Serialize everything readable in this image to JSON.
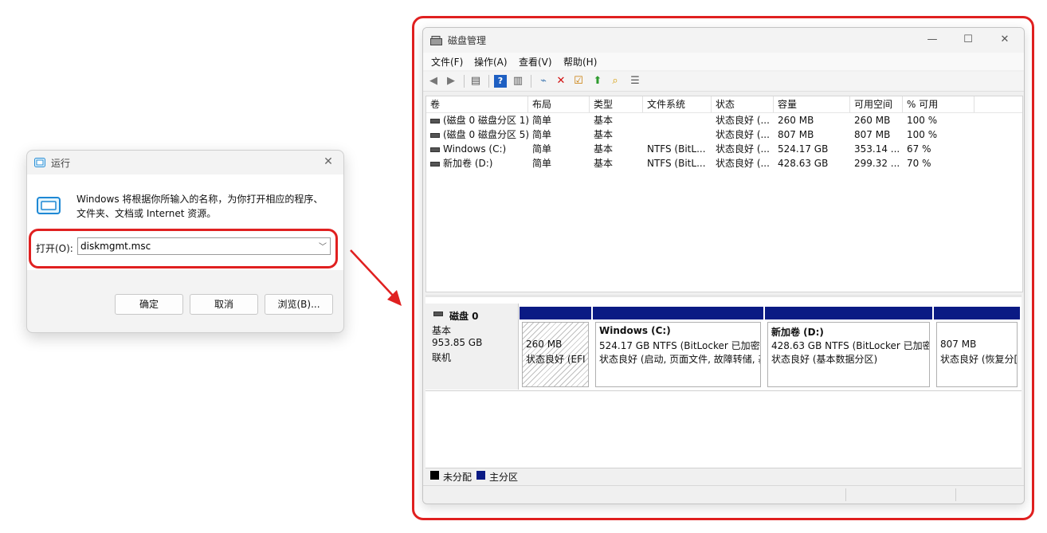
{
  "run_dialog": {
    "title": "运行",
    "description": "Windows 将根据你所输入的名称，为你打开相应的程序、文件夹、文档或 Internet 资源。",
    "open_label": "打开(O):",
    "command_value": "diskmgmt.msc",
    "ok_button": "确定",
    "cancel_button": "取消",
    "browse_button": "浏览(B)...",
    "icons": {
      "app": "run-app-icon",
      "close": "close-icon",
      "dropdown": "chevron-down-icon"
    }
  },
  "disk_mgmt": {
    "title": "磁盘管理",
    "menu": [
      "文件(F)",
      "操作(A)",
      "查看(V)",
      "帮助(H)"
    ],
    "toolbar_icons": [
      "back-icon",
      "forward-icon",
      "console-tree-icon",
      "help-icon",
      "action-pane-icon",
      "connect-icon",
      "delete-icon",
      "properties-icon",
      "up-icon",
      "search-icon",
      "view-icon"
    ],
    "columns": [
      "卷",
      "布局",
      "类型",
      "文件系统",
      "状态",
      "容量",
      "可用空间",
      "% 可用"
    ],
    "volumes": [
      [
        "(磁盘 0 磁盘分区 1)",
        "简单",
        "基本",
        "",
        "状态良好 (...",
        "260 MB",
        "260 MB",
        "100 %"
      ],
      [
        "(磁盘 0 磁盘分区 5)",
        "简单",
        "基本",
        "",
        "状态良好 (...",
        "807 MB",
        "807 MB",
        "100 %"
      ],
      [
        "Windows (C:)",
        "简单",
        "基本",
        "NTFS (BitL...",
        "状态良好 (...",
        "524.17 GB",
        "353.14 ...",
        "67 %"
      ],
      [
        "新加卷 (D:)",
        "简单",
        "基本",
        "NTFS (BitL...",
        "状态良好 (...",
        "428.63 GB",
        "299.32 ...",
        "70 %"
      ]
    ],
    "disk": {
      "name": "磁盘 0",
      "type": "基本",
      "size": "953.85 GB",
      "status": "联机",
      "partitions": [
        {
          "title": "",
          "line1": "260 MB",
          "line2": "状态良好 (EFI",
          "hatched": true
        },
        {
          "title": "Windows  (C:)",
          "line1": "524.17 GB NTFS (BitLocker 已加密)",
          "line2": "状态良好 (启动, 页面文件, 故障转储, 基",
          "hatched": false
        },
        {
          "title": "新加卷  (D:)",
          "line1": "428.63 GB NTFS (BitLocker 已加密)",
          "line2": "状态良好 (基本数据分区)",
          "hatched": false
        },
        {
          "title": "",
          "line1": "807 MB",
          "line2": "状态良好 (恢复分[",
          "hatched": false
        }
      ]
    },
    "legend": [
      {
        "label": "未分配",
        "color": "#000000"
      },
      {
        "label": "主分区",
        "color": "#0a1a84"
      }
    ]
  },
  "colors": {
    "annotation": "#e02020",
    "primary_partition": "#0a1a84"
  }
}
